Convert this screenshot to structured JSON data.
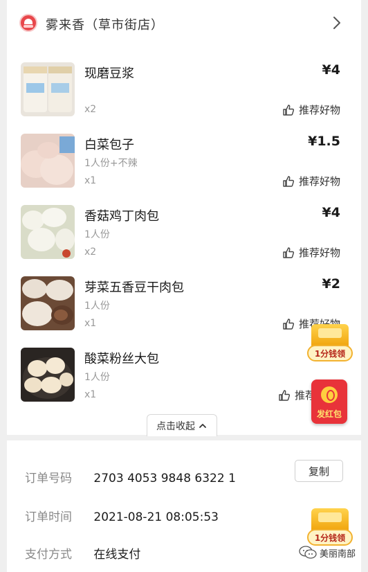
{
  "store": {
    "name": "雾来香（草市街店）",
    "chevron_icon": "chevron-right-icon",
    "logo_icon": "store-logo-icon"
  },
  "items": [
    {
      "name": "现磨豆浆",
      "spec": "",
      "qty": "x2",
      "price": "¥4",
      "recommend": "推荐好物",
      "image": "soy-milk-cups"
    },
    {
      "name": "白菜包子",
      "spec": "1人份+不辣",
      "qty": "x1",
      "price": "¥1.5",
      "recommend": "推荐好物",
      "image": "cabbage-buns"
    },
    {
      "name": "香菇鸡丁肉包",
      "spec": "1人份",
      "qty": "x2",
      "price": "¥4",
      "recommend": "推荐好物",
      "image": "mushroom-chicken-buns"
    },
    {
      "name": "芽菜五香豆干肉包",
      "spec": "1人份",
      "qty": "x1",
      "price": "¥2",
      "recommend": "推荐好物",
      "image": "sprout-tofu-buns"
    },
    {
      "name": "酸菜粉丝大包",
      "spec": "1人份",
      "qty": "x1",
      "price": "",
      "recommend": "推荐",
      "image": "pickled-vermicelli-buns"
    }
  ],
  "collapse_label": "点击收起",
  "order": {
    "number_label": "订单号码",
    "number_value": "2703 4053 9848 6322 1",
    "copy_label": "复制",
    "time_label": "订单时间",
    "time_value": "2021-08-21 08:05:53",
    "pay_label": "支付方式",
    "pay_value": "在线支付"
  },
  "floats": {
    "coin_label": "1分钱领",
    "red_packet_label": "发红包"
  },
  "watermark": {
    "text": "美丽南部",
    "icon": "wechat-icon"
  },
  "colors": {
    "price": "#1a1a1a",
    "muted": "#999999",
    "red_packet": "#e8333a",
    "coin": "#f0a20a"
  }
}
